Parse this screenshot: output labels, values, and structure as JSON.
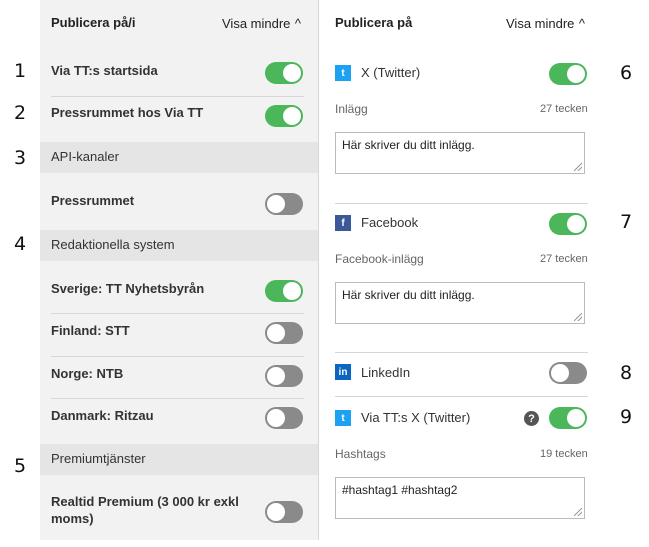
{
  "left": {
    "title": "Publicera på/i",
    "show_less": "Visa mindre",
    "chevron": "^"
  },
  "right": {
    "title": "Publicera på",
    "show_less": "Visa mindre",
    "chevron": "^"
  },
  "numbers": [
    "1",
    "2",
    "3",
    "4",
    "5",
    "6",
    "7",
    "8",
    "9"
  ],
  "left_rows": {
    "via_tt": {
      "label": "Via TT:s startsida",
      "on": true
    },
    "pressrummet_via_tt": {
      "label": "Pressrummet hos Via TT",
      "on": true
    },
    "api_section": "API-kanaler",
    "pressrummet": {
      "label": "Pressrummet",
      "on": false
    },
    "editorial_section": "Redaktionella system",
    "sverige": {
      "label": "Sverige: TT Nyhetsbyrån",
      "on": true
    },
    "finland": {
      "label": "Finland: STT",
      "on": false
    },
    "norge": {
      "label": "Norge: NTB",
      "on": false
    },
    "danmark": {
      "label": "Danmark: Ritzau",
      "on": false
    },
    "premium_section": "Premiumtjänster",
    "realtid_line1": "Realtid Premium (3 000 kr exkl",
    "realtid_line2": "moms)",
    "realtid_on": false
  },
  "channels": {
    "twitter": {
      "label": "X (Twitter)",
      "on": true,
      "icon": "twitter-icon",
      "field_label": "Inlägg",
      "count": "27 tecken",
      "text": "Här skriver du ditt inlägg."
    },
    "facebook": {
      "label": "Facebook",
      "on": true,
      "icon": "facebook-icon",
      "field_label": "Facebook-inlägg",
      "count": "27 tecken",
      "text": "Här skriver du ditt inlägg."
    },
    "linkedin": {
      "label": "LinkedIn",
      "on": false,
      "icon": "linkedin-icon"
    },
    "via_tt_twitter": {
      "label": "Via TT:s X (Twitter)",
      "on": true,
      "icon": "twitter-icon",
      "help": "?",
      "field_label": "Hashtags",
      "count": "19 tecken",
      "text": "#hashtag1 #hashtag2"
    }
  },
  "colors": {
    "toggle_on": "#4cb65a",
    "toggle_off": "#8a8a8a",
    "twitter": "#1da1f2",
    "facebook": "#3b5998",
    "linkedin": "#0a66c2"
  }
}
